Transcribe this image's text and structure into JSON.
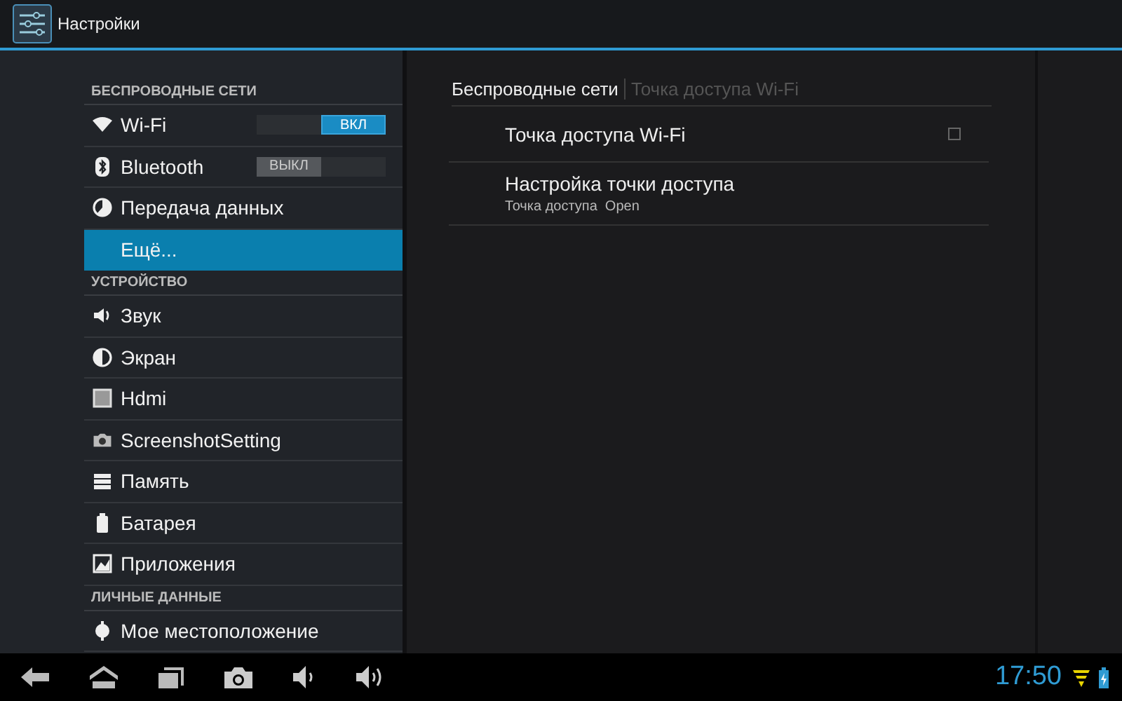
{
  "action_bar": {
    "title": "Настройки"
  },
  "sidebar": {
    "sections": [
      {
        "header": "БЕСПРОВОДНЫЕ СЕТИ",
        "items": [
          {
            "label": "Wi-Fi",
            "selected": false,
            "toggle": {
              "on": true,
              "label": "ВКЛ"
            }
          },
          {
            "label": "Bluetooth",
            "selected": false,
            "toggle": {
              "on": false,
              "label": "ВЫКЛ"
            }
          },
          {
            "label": "Передача данных",
            "selected": false
          },
          {
            "label": "Ещё...",
            "selected": true
          }
        ]
      },
      {
        "header": "УСТРОЙСТВО",
        "items": [
          {
            "label": "Звук",
            "selected": false
          },
          {
            "label": "Экран",
            "selected": false
          },
          {
            "label": "Hdmi",
            "selected": false
          },
          {
            "label": "ScreenshotSetting",
            "selected": false
          },
          {
            "label": "Память",
            "selected": false
          },
          {
            "label": "Батарея",
            "selected": false
          },
          {
            "label": "Приложения",
            "selected": false
          }
        ]
      },
      {
        "header": "ЛИЧНЫЕ ДАННЫЕ",
        "items": [
          {
            "label": "Мое местоположение",
            "selected": false
          }
        ]
      }
    ]
  },
  "detail": {
    "breadcrumb": [
      "Беспроводные сети",
      "Точка доступа Wi-Fi"
    ],
    "items": [
      {
        "kind": "checkbox",
        "title": "Точка доступа Wi-Fi",
        "checked": false
      },
      {
        "kind": "plain",
        "title": "Настройка точки доступа",
        "summary": "Точка доступа  Open"
      }
    ]
  },
  "status_bar": {
    "time": "17:50"
  }
}
